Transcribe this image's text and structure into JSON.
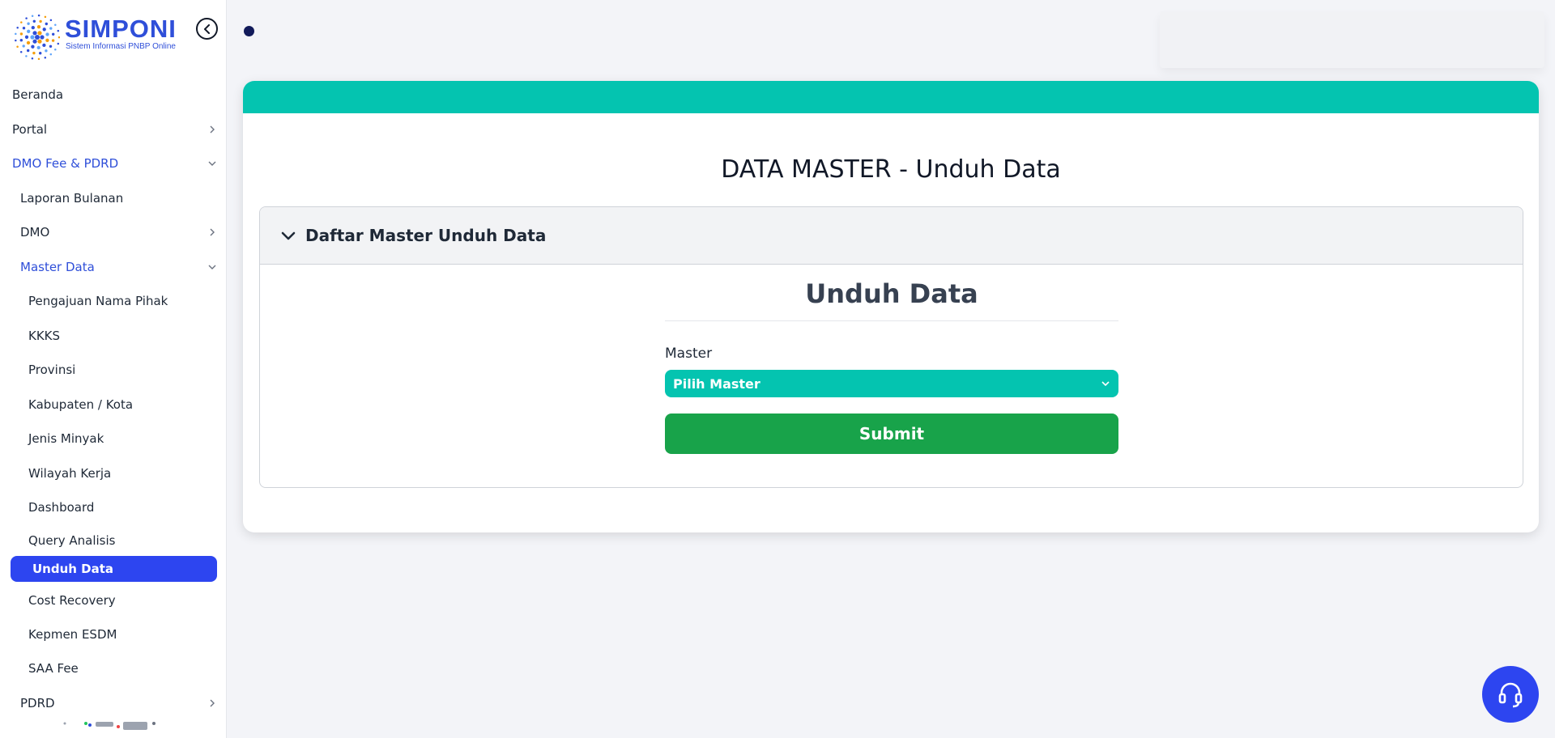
{
  "brand": {
    "title": "SIMPONI",
    "subtitle": "Sistem Informasi PNBP Online",
    "brand_color": "#2f4fd9"
  },
  "sidebar": {
    "collapse_icon": "chevron-left-circle-icon",
    "items": [
      {
        "label": "Beranda",
        "level": 0,
        "has_children": false
      },
      {
        "label": "Portal",
        "level": 0,
        "has_children": true,
        "expanded": false
      },
      {
        "label": "DMO Fee & PDRD",
        "level": 0,
        "has_children": true,
        "expanded": true
      },
      {
        "label": "Laporan Bulanan",
        "level": 1,
        "has_children": false
      },
      {
        "label": "DMO",
        "level": 1,
        "has_children": true,
        "expanded": false
      },
      {
        "label": "Master Data",
        "level": 1,
        "has_children": true,
        "expanded": true
      },
      {
        "label": "Pengajuan Nama Pihak",
        "level": 2
      },
      {
        "label": "KKKS",
        "level": 2
      },
      {
        "label": "Provinsi",
        "level": 2
      },
      {
        "label": "Kabupaten / Kota",
        "level": 2
      },
      {
        "label": "Jenis Minyak",
        "level": 2
      },
      {
        "label": "Wilayah Kerja",
        "level": 2
      },
      {
        "label": "Dashboard",
        "level": 2
      },
      {
        "label": "Query Analisis",
        "level": 2
      },
      {
        "label": "Unduh Data",
        "level": 2,
        "active": true
      },
      {
        "label": "Cost Recovery",
        "level": 2
      },
      {
        "label": "Kepmen ESDM",
        "level": 2
      },
      {
        "label": "SAA Fee",
        "level": 2
      },
      {
        "label": "PDRD",
        "level": 1,
        "has_children": true,
        "expanded": false
      }
    ],
    "active_color": "#2d45f0"
  },
  "main": {
    "header_color": "#04c4b0",
    "page_title": "DATA MASTER - Unduh Data",
    "accordion": {
      "title": "Daftar Master Unduh Data",
      "icon": "chevron-down-icon"
    },
    "form": {
      "title": "Unduh Data",
      "master_label": "Master",
      "master_select_value": "Pilih Master",
      "submit_label": "Submit",
      "submit_color": "#18a34a"
    }
  },
  "help_button_icon": "headset-icon"
}
